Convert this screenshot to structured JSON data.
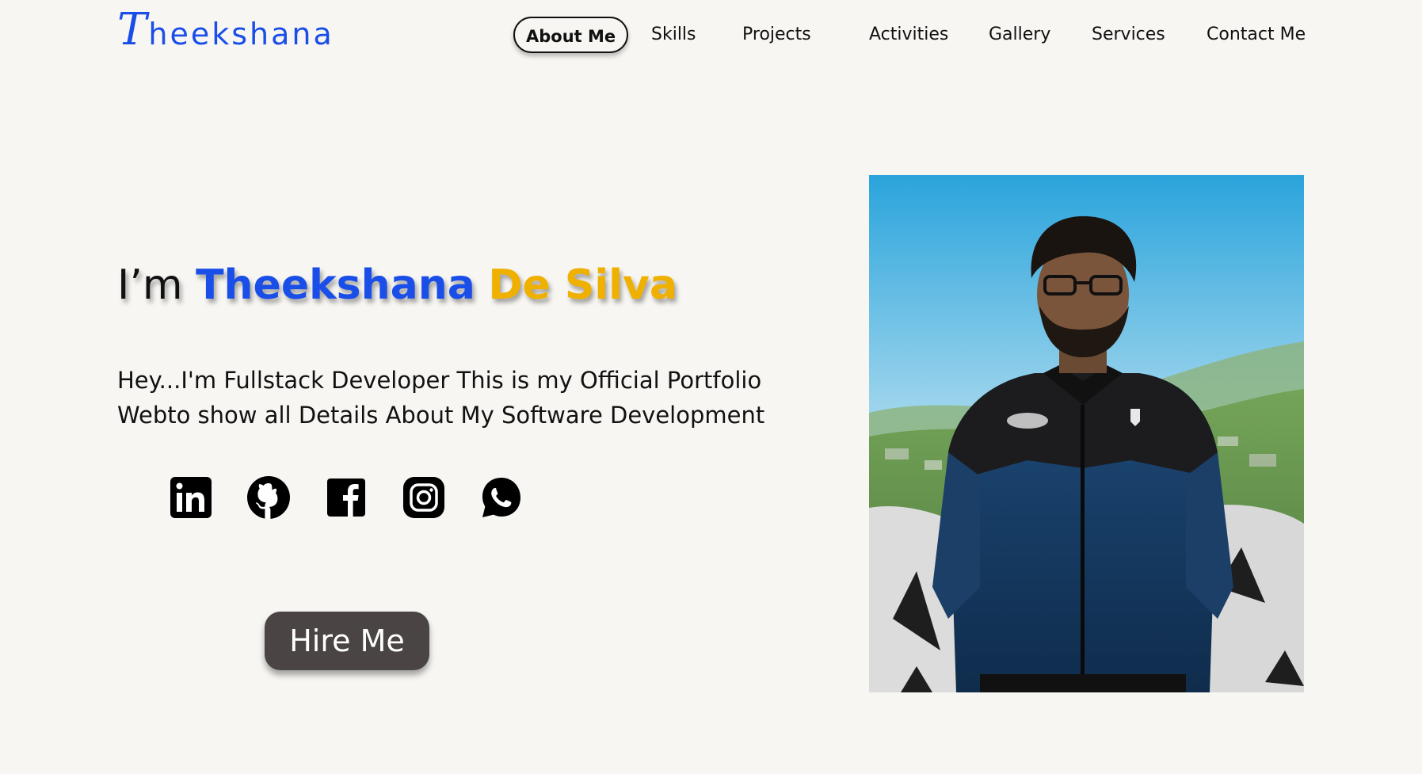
{
  "header": {
    "logo_initial": "T",
    "logo_rest": "heekshana",
    "nav": [
      {
        "label": "About Me",
        "active": true
      },
      {
        "label": "Skills"
      },
      {
        "label": "Projects"
      },
      {
        "label": "Activities"
      },
      {
        "label": "Gallery"
      },
      {
        "label": "Services"
      },
      {
        "label": "Contact Me"
      }
    ]
  },
  "hero": {
    "prefix": "I’m",
    "first_name": "Theekshana",
    "last_name": "De Silva",
    "intro_line1": "Hey...I'm Fullstack Developer This is my Official Portfolio",
    "intro_line2": "Webto show all Details About My Software Development",
    "hire_label": "Hire Me"
  },
  "socials": [
    {
      "icon": "linkedin-icon"
    },
    {
      "icon": "github-icon"
    },
    {
      "icon": "facebook-icon"
    },
    {
      "icon": "instagram-icon"
    },
    {
      "icon": "whatsapp-icon"
    }
  ],
  "colors": {
    "accent_blue": "#1a4ee8",
    "accent_gold": "#f0b000",
    "background": "#f7f6f2",
    "button": "#4a4544"
  }
}
